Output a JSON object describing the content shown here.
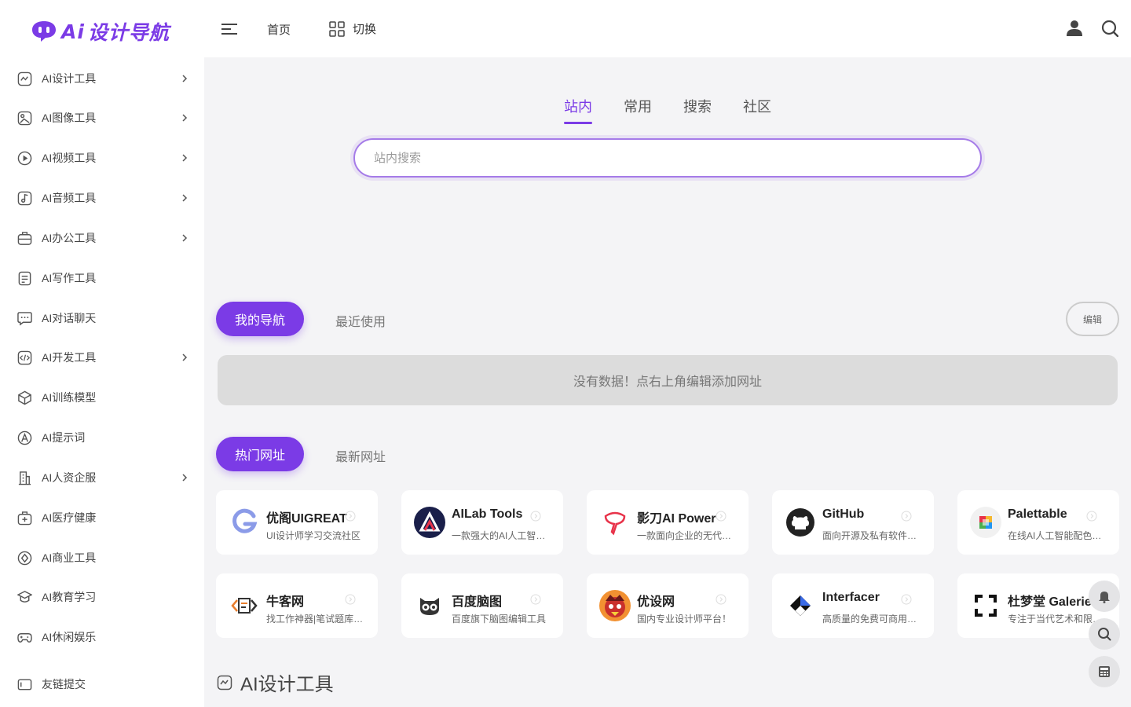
{
  "header": {
    "logo_text": "设计导航",
    "logo_prefix": "Ai",
    "nav_home": "首页",
    "nav_switch": "切换"
  },
  "sidebar": {
    "items": [
      {
        "label": "AI设计工具",
        "icon": "design-icon",
        "arrow": true
      },
      {
        "label": "AI图像工具",
        "icon": "image-icon",
        "arrow": true
      },
      {
        "label": "AI视频工具",
        "icon": "video-icon",
        "arrow": true
      },
      {
        "label": "AI音频工具",
        "icon": "audio-icon",
        "arrow": true
      },
      {
        "label": "AI办公工具",
        "icon": "office-icon",
        "arrow": true
      },
      {
        "label": "AI写作工具",
        "icon": "writing-icon",
        "arrow": false
      },
      {
        "label": "AI对话聊天",
        "icon": "chat-icon",
        "arrow": false
      },
      {
        "label": "AI开发工具",
        "icon": "code-icon",
        "arrow": true
      },
      {
        "label": "AI训练模型",
        "icon": "model-icon",
        "arrow": false
      },
      {
        "label": "AI提示词",
        "icon": "prompt-icon",
        "arrow": false
      },
      {
        "label": "AI人资企服",
        "icon": "enterprise-icon",
        "arrow": true
      },
      {
        "label": "AI医疗健康",
        "icon": "medical-icon",
        "arrow": false
      },
      {
        "label": "AI商业工具",
        "icon": "business-icon",
        "arrow": false
      },
      {
        "label": "AI教育学习",
        "icon": "education-icon",
        "arrow": false
      },
      {
        "label": "AI休闲娱乐",
        "icon": "gamepad-icon",
        "arrow": false
      },
      {
        "label": "友链提交",
        "icon": "link-submit-icon",
        "arrow": false
      }
    ]
  },
  "search": {
    "tabs": [
      "站内",
      "常用",
      "搜索",
      "社区"
    ],
    "active_tab": "站内",
    "placeholder": "站内搜索",
    "value": ""
  },
  "my_nav": {
    "tab_active": "我的导航",
    "tab_other": "最近使用",
    "edit_label": "编辑",
    "empty_text": "没有数据！点右上角编辑添加网址"
  },
  "hot": {
    "tab_active": "热门网址",
    "tab_other": "最新网址",
    "cards": [
      {
        "title": "优阁UIGREAT",
        "desc": "UI设计师学习交流社区",
        "logo": "uigreat-logo"
      },
      {
        "title": "AILab Tools",
        "desc": "一款强大的AI人工智能工具",
        "logo": "ailab-logo"
      },
      {
        "title": "影刀AI Power",
        "desc": "一款面向企业的无代码AI平台",
        "logo": "yingdao-logo"
      },
      {
        "title": "GitHub",
        "desc": "面向开源及私有软件项目的托管平台",
        "logo": "github-logo"
      },
      {
        "title": "Palettable",
        "desc": "在线AI人工智能配色生成工具",
        "logo": "palettable-logo"
      },
      {
        "title": "牛客网",
        "desc": "找工作神器|笔试题库|面试经验",
        "logo": "nowcoder-logo"
      },
      {
        "title": "百度脑图",
        "desc": "百度旗下脑图编辑工具",
        "logo": "baidu-naotu-logo"
      },
      {
        "title": "优设网",
        "desc": "国内专业设计师平台！",
        "logo": "uisdc-logo"
      },
      {
        "title": "Interfacer",
        "desc": "高质量的免费可商用设计资源",
        "logo": "interfacer-logo"
      },
      {
        "title": "杜梦堂 Galerie",
        "desc": "专注于当代艺术和限量版画",
        "logo": "dumengtang-logo"
      }
    ]
  },
  "section": {
    "title": "AI设计工具"
  },
  "colors": {
    "accent": "#7b3be6",
    "background": "#f4f4f6"
  }
}
